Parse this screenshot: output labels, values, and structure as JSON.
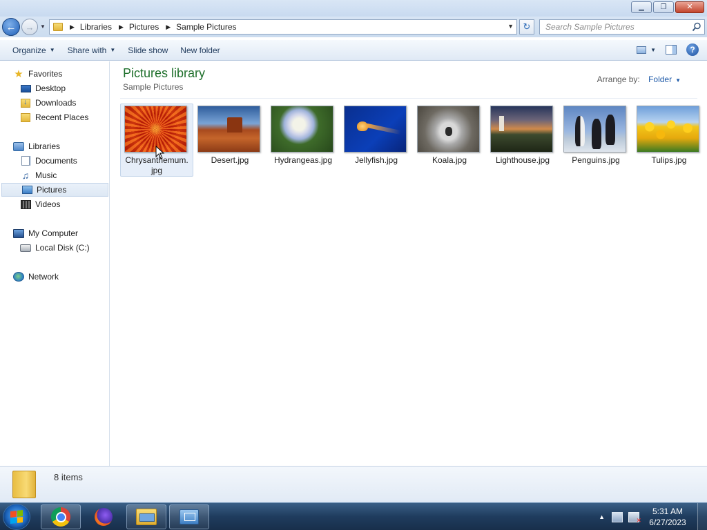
{
  "window": {
    "minimize_glyph": "▁",
    "restore_glyph": "❐",
    "close_glyph": "✕"
  },
  "address": {
    "crumbs": [
      "Libraries",
      "Pictures",
      "Sample Pictures"
    ]
  },
  "search": {
    "placeholder": "Search Sample Pictures"
  },
  "toolbar": {
    "organize": "Organize",
    "share_with": "Share with",
    "slide_show": "Slide show",
    "new_folder": "New folder"
  },
  "nav": {
    "favorites": "Favorites",
    "desktop": "Desktop",
    "downloads": "Downloads",
    "recent_places": "Recent Places",
    "libraries": "Libraries",
    "documents": "Documents",
    "music": "Music",
    "pictures": "Pictures",
    "videos": "Videos",
    "my_computer": "My Computer",
    "local_disk": "Local Disk (C:)",
    "network": "Network"
  },
  "library": {
    "title": "Pictures library",
    "subtitle": "Sample Pictures",
    "arrange_label": "Arrange by:",
    "arrange_value": "Folder"
  },
  "files": [
    {
      "name_line1": "Chrysanthemum.",
      "name_line2": "jpg",
      "selected": true
    },
    {
      "name_line1": "Desert.jpg",
      "name_line2": ""
    },
    {
      "name_line1": "Hydrangeas.jpg",
      "name_line2": ""
    },
    {
      "name_line1": "Jellyfish.jpg",
      "name_line2": ""
    },
    {
      "name_line1": "Koala.jpg",
      "name_line2": ""
    },
    {
      "name_line1": "Lighthouse.jpg",
      "name_line2": ""
    },
    {
      "name_line1": "Penguins.jpg",
      "name_line2": ""
    },
    {
      "name_line1": "Tulips.jpg",
      "name_line2": ""
    }
  ],
  "details": {
    "item_count": "8 items"
  },
  "taskbar": {
    "time": "5:31 AM",
    "date": "6/27/2023"
  },
  "colors": {
    "library_title": "#1e6f2b",
    "link_blue": "#1e5aa8",
    "selection_bg": "#e6eef9"
  }
}
